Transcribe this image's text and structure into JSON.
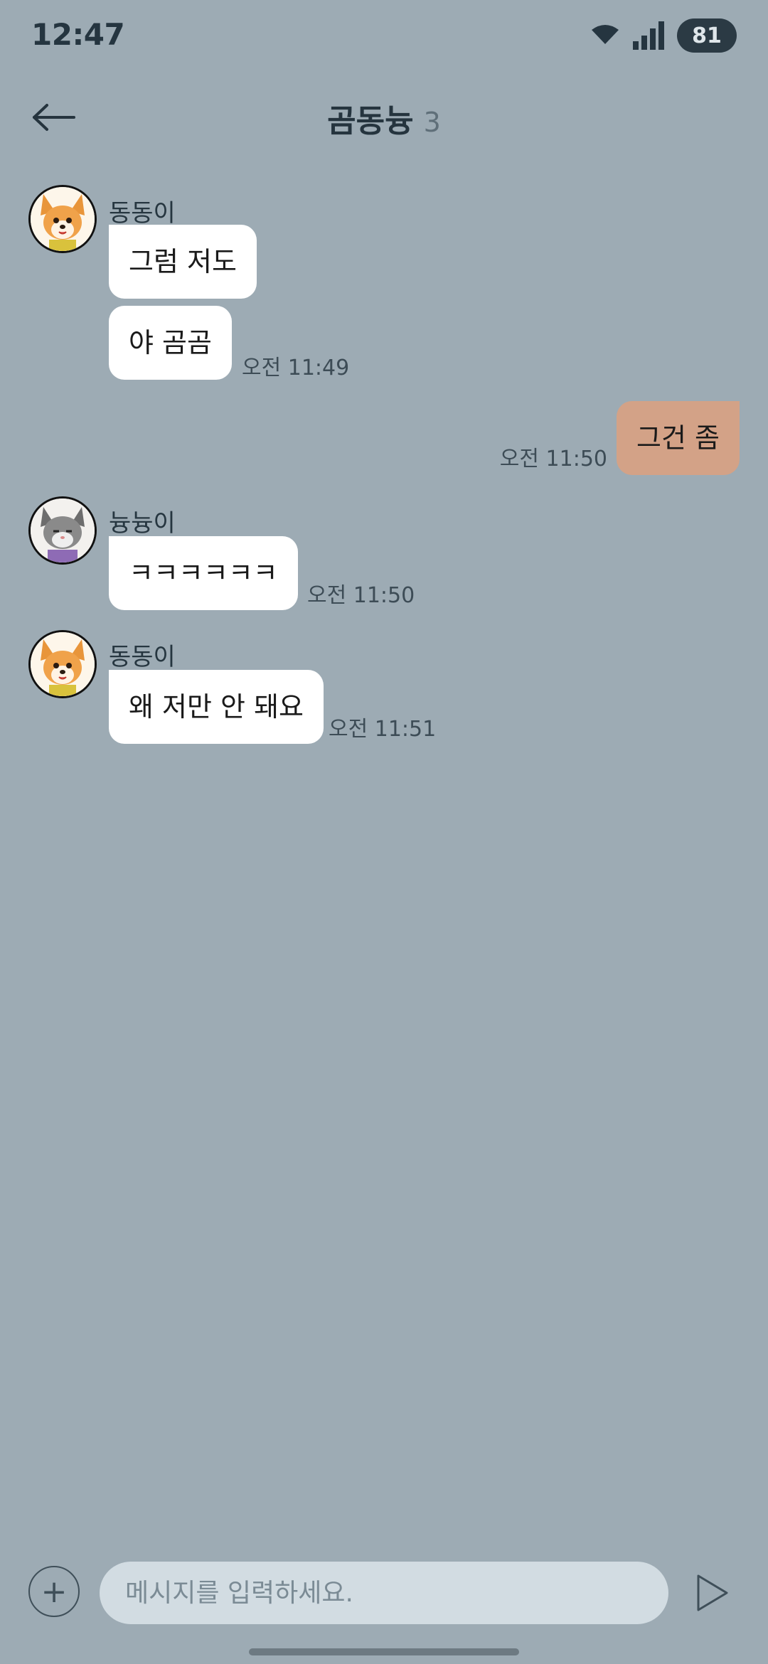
{
  "status_bar": {
    "time": "12:47",
    "battery": "81",
    "icons": [
      "wifi-icon",
      "signal-icon"
    ]
  },
  "header": {
    "title": "곰동늉",
    "member_count": "3",
    "back_icon": "arrow-left-icon"
  },
  "messages": [
    {
      "sender": "동동이",
      "avatar": "dog-avatar",
      "bubbles": [
        "그럼 저도",
        "야 곰곰"
      ],
      "time": "오전 11:49"
    },
    {
      "sender": "me",
      "bubbles": [
        "그건 좀"
      ],
      "time": "오전 11:50"
    },
    {
      "sender": "늉늉이",
      "avatar": "cat-avatar",
      "bubbles": [
        "ㅋㅋㅋㅋㅋㅋ"
      ],
      "time": "오전 11:50"
    },
    {
      "sender": "동동이",
      "avatar": "dog-avatar",
      "bubbles": [
        "왜 저만 안 돼요"
      ],
      "time": "오전 11:51"
    }
  ],
  "input": {
    "placeholder": "메시지를 입력하세요.",
    "value": "",
    "plus_label": "+"
  },
  "colors": {
    "background": "#9dabb4",
    "my_bubble": "#d3a287",
    "other_bubble": "#ffffff",
    "input_field": "#d2dce2"
  }
}
